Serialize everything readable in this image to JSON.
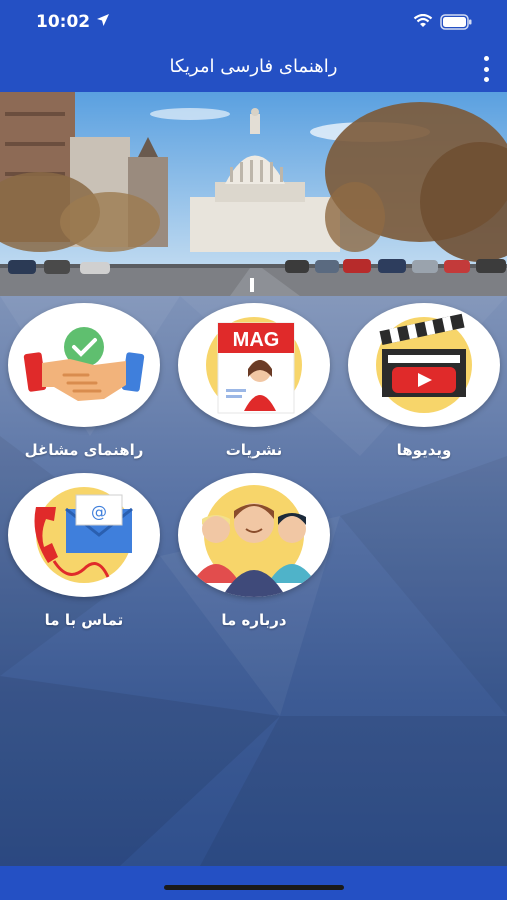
{
  "status": {
    "time": "10:02"
  },
  "app_bar": {
    "title": "راهنمای فارسی امریکا",
    "menu_icon": "more-vertical-icon"
  },
  "banner": {
    "description_icon": "capitol-building-photo"
  },
  "menu": [
    {
      "label": "ویدیوها",
      "icon": "video-clapperboard-icon"
    },
    {
      "label": "نشریات",
      "icon": "magazine-icon"
    },
    {
      "label": "راهنمای مشاغل",
      "icon": "handshake-icon"
    },
    {
      "label": "درباره ما",
      "icon": "people-group-icon"
    },
    {
      "label": "تماس با ما",
      "icon": "contact-phone-email-icon"
    }
  ],
  "colors": {
    "primary": "#2450c4",
    "accent_red": "#e02a2a",
    "accent_yellow": "#f5d36a"
  }
}
